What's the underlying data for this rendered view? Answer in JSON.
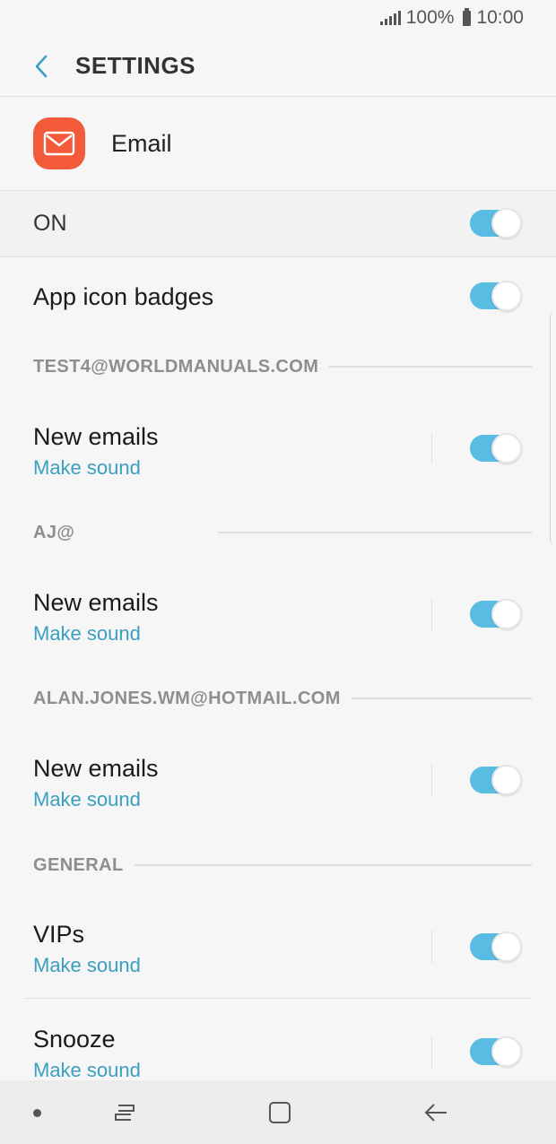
{
  "status_bar": {
    "battery": "100%",
    "time": "10:00"
  },
  "header": {
    "title": "SETTINGS"
  },
  "app": {
    "name": "Email"
  },
  "master": {
    "label": "ON",
    "on": true
  },
  "badges": {
    "label": "App icon badges",
    "on": true
  },
  "accounts": [
    {
      "name": "TEST4@WORLDMANUALS.COM",
      "title": "New emails",
      "sub": "Make sound",
      "on": true
    },
    {
      "name": "AJ@",
      "title": "New emails",
      "sub": "Make sound",
      "on": true
    },
    {
      "name": "ALAN.JONES.WM@HOTMAIL.COM",
      "title": "New emails",
      "sub": "Make sound",
      "on": true
    }
  ],
  "general": {
    "label": "GENERAL",
    "items": [
      {
        "title": "VIPs",
        "sub": "Make sound",
        "on": true
      },
      {
        "title": "Snooze",
        "sub": "Make sound",
        "on": true
      }
    ]
  },
  "colors": {
    "accent": "#59bce2",
    "link": "#3a9fc0",
    "app_icon": "#f25a3a"
  },
  "nav_icons": [
    "recent-apps-icon",
    "home-icon",
    "back-icon"
  ]
}
